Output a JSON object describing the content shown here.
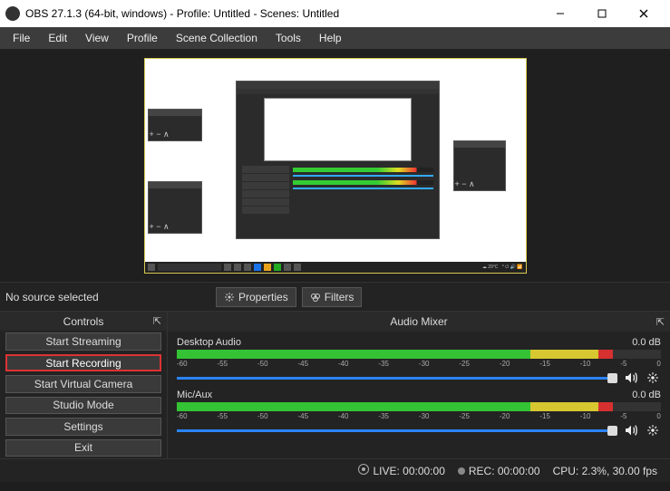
{
  "window": {
    "title": "OBS 27.1.3 (64-bit, windows) - Profile: Untitled - Scenes: Untitled"
  },
  "menu": {
    "file": "File",
    "edit": "Edit",
    "view": "View",
    "profile": "Profile",
    "scene_collection": "Scene Collection",
    "tools": "Tools",
    "help": "Help"
  },
  "source_bar": {
    "status": "No source selected",
    "properties": "Properties",
    "filters": "Filters"
  },
  "controls": {
    "header": "Controls",
    "start_streaming": "Start Streaming",
    "start_recording": "Start Recording",
    "start_virtual_camera": "Start Virtual Camera",
    "studio_mode": "Studio Mode",
    "settings": "Settings",
    "exit": "Exit"
  },
  "mixer": {
    "header": "Audio Mixer",
    "tracks": [
      {
        "name": "Desktop Audio",
        "level": "0.0 dB"
      },
      {
        "name": "Mic/Aux",
        "level": "0.0 dB"
      }
    ],
    "scale": [
      "-60",
      "-55",
      "-50",
      "-45",
      "-40",
      "-35",
      "-30",
      "-25",
      "-20",
      "-15",
      "-10",
      "-5",
      "0"
    ]
  },
  "status": {
    "live": "LIVE: 00:00:00",
    "rec": "REC: 00:00:00",
    "cpu": "CPU: 2.3%, 30.00 fps"
  },
  "icons": {
    "gear": "gear",
    "speaker": "speaker",
    "popout": "popout",
    "minimize": "minimize",
    "maximize": "maximize",
    "close": "close"
  }
}
